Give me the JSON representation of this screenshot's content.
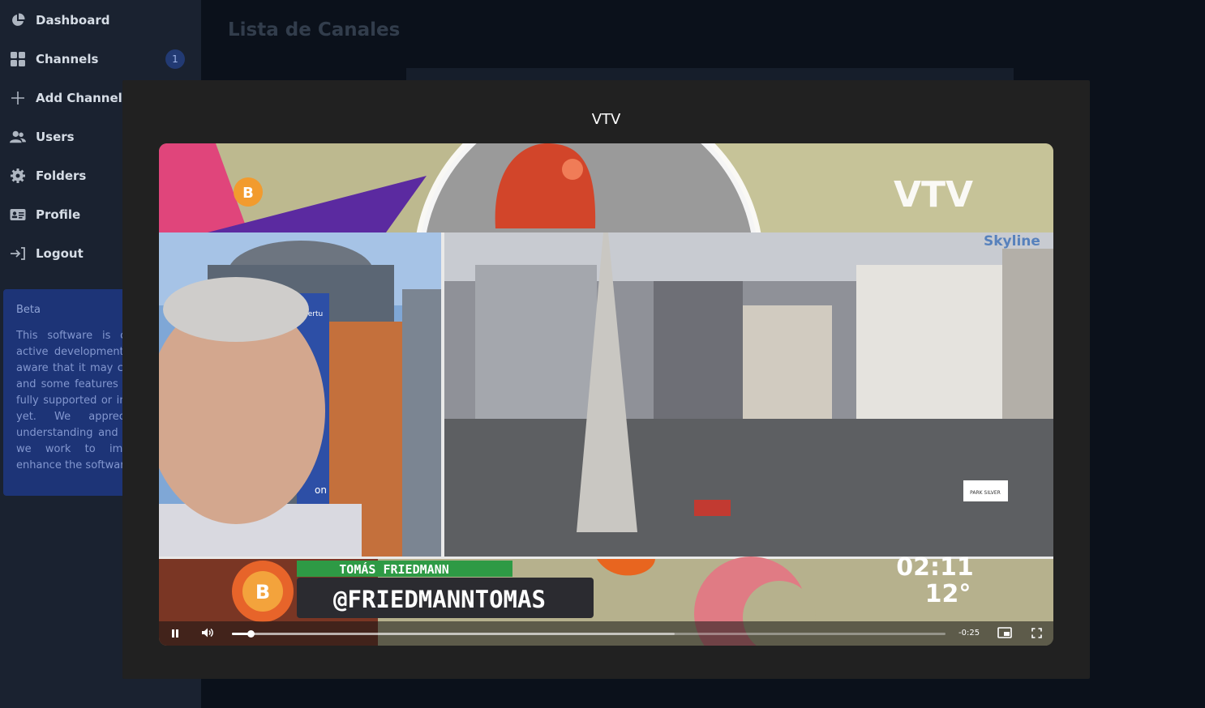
{
  "sidebar": {
    "items": [
      {
        "label": "Dashboard",
        "icon": "dashboard-icon"
      },
      {
        "label": "Channels",
        "icon": "grid-icon",
        "badge": "1"
      },
      {
        "label": "Add Channels",
        "icon": "plus-icon"
      },
      {
        "label": "Users",
        "icon": "users-icon"
      },
      {
        "label": "Folders",
        "icon": "gear-icon"
      },
      {
        "label": "Profile",
        "icon": "id-card-icon"
      },
      {
        "label": "Logout",
        "icon": "logout-icon"
      }
    ],
    "beta": {
      "title": "Beta",
      "text": "This software is currently in active development. Please be aware that it may contain bugs and some features may not be fully supported or implemented yet. We appreciate your understanding and patience as we work to improve and enhance the software."
    }
  },
  "main": {
    "title": "Lista de Canales"
  },
  "modal": {
    "title": "VTV",
    "video": {
      "channel_logo": "VTV",
      "watermark": "Skyline",
      "lower_third_name": "TOMÁS FRIEDMANN",
      "lower_third_handle": "@FRIEDMANNTOMAS",
      "clock": "02:11",
      "temperature": "12°",
      "side_sign": "on me",
      "building_sign": "bertu",
      "billboard_text": "PARK SILVER"
    },
    "player": {
      "state": "playing",
      "progress": 0.026,
      "buffered": 0.62,
      "time_remaining": "-0:25",
      "icons": [
        "pause-icon",
        "volume-icon",
        "picture-in-picture-icon",
        "fullscreen-icon"
      ]
    }
  },
  "colors": {
    "sidebar_bg": "#1a2230",
    "page_bg": "#0b111b",
    "modal_bg": "#212121",
    "beta_bg": "#1d3477",
    "badge_bg": "#223a73",
    "lower_third_green": "#2e9a45",
    "accent_orange": "#e7642a"
  }
}
